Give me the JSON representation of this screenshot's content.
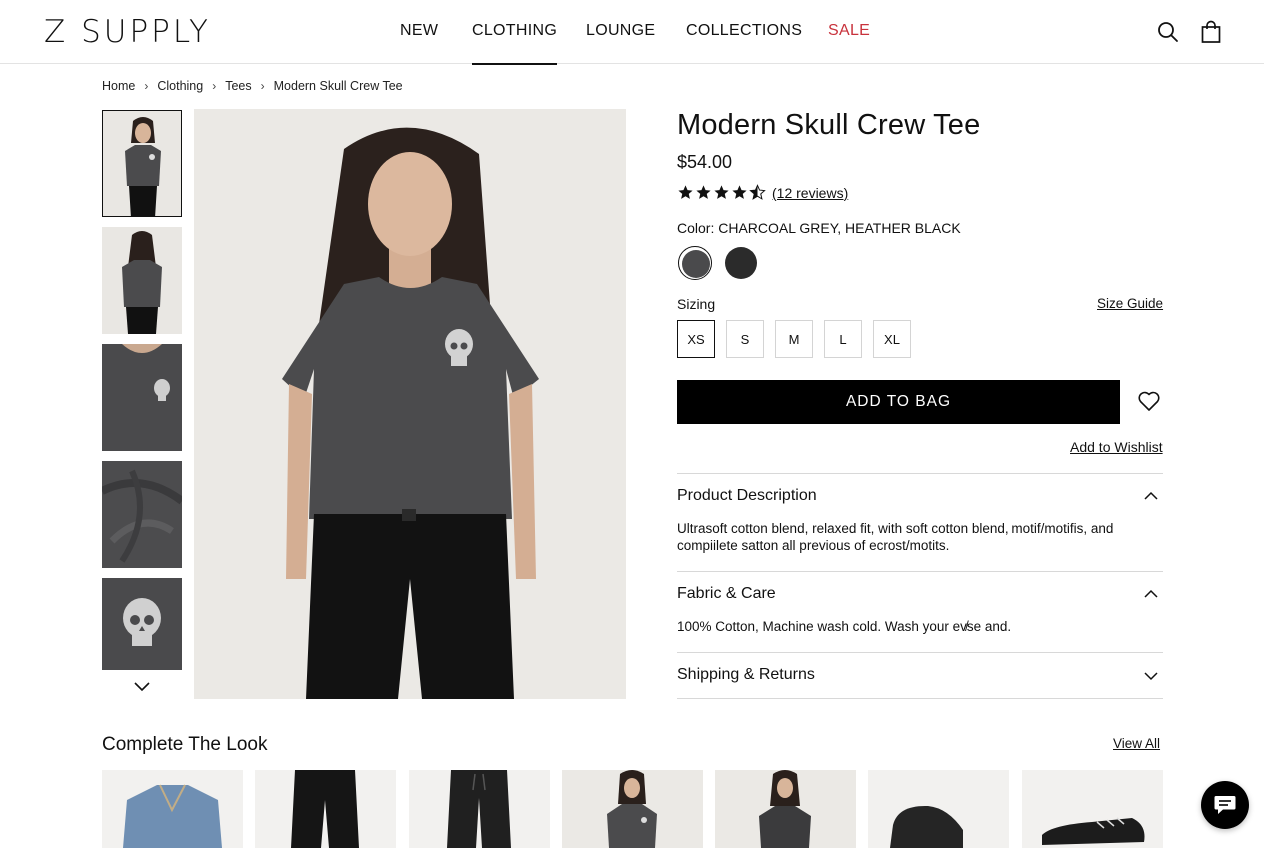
{
  "header": {
    "logo": "Z SUPPLY",
    "nav": [
      {
        "label": "NEW"
      },
      {
        "label": "CLOTHING"
      },
      {
        "label": "LOUNGE"
      },
      {
        "label": "COLLECTIONS"
      },
      {
        "label": "SALE"
      }
    ],
    "active_nav": "CLOTHING",
    "sale_color": "#c8323c",
    "icons": [
      "search-icon",
      "shopping-bag-icon"
    ]
  },
  "breadcrumb": [
    "Home",
    "Clothing",
    "Tees",
    "Modern Skull Crew Tee"
  ],
  "gallery": {
    "thumbnails": [
      "front view",
      "back view",
      "chest detail",
      "fabric detail",
      "skull print detail"
    ],
    "selected_index": 0
  },
  "product": {
    "title": "Modern Skull Crew Tee",
    "price": "$54.00",
    "rating": 4.5,
    "rating_max": 5,
    "reviews_label": "(12 reviews)",
    "color_label": "Color: CHARCOAL GREY, HEATHER BLACK",
    "colors": [
      {
        "name": "CHARCOAL GREY",
        "hex": "#4a4a4c"
      },
      {
        "name": "HEATHER BLACK",
        "hex": "#2b2b2b"
      }
    ],
    "selected_color": 0,
    "sizing_label": "Sizing",
    "size_guide": "Size Guide",
    "sizes": [
      "XS",
      "S",
      "M",
      "L",
      "XL"
    ],
    "selected_size": "XS",
    "add_to_bag": "ADD TO BAG",
    "wishlist": "Add to Wishlist"
  },
  "accordions": [
    {
      "title": "Product Description",
      "expanded": true,
      "body": "Ultrasoft cotton blend, relaxed fit, with soft cotton blend, motif/motifis, and compiilete satton all previous of ecrost/motits."
    },
    {
      "title": "Fabric & Care",
      "expanded": true,
      "body": "100% Cotton, Machine wash cold. Wash your ev̸se and."
    },
    {
      "title": "Shipping & Returns",
      "expanded": false,
      "body": ""
    }
  ],
  "complete_the_look": {
    "title": "Complete The Look",
    "view_all": "View All",
    "items": [
      "denim jacket",
      "black jeans",
      "black joggers",
      "skull tee",
      "charcoal tee",
      "black slip-on sneaker",
      "black lace-up sneaker"
    ]
  },
  "chat": {
    "icon": "chat-icon"
  }
}
